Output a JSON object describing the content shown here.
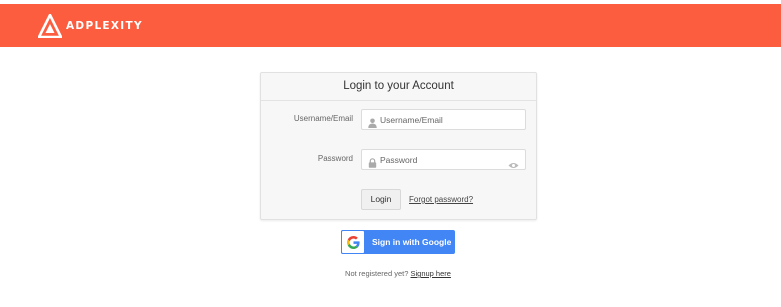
{
  "header": {
    "brand": "ADPLEXITY",
    "bar_color": "#fc5d3f"
  },
  "login_card": {
    "title": "Login to your Account",
    "username": {
      "label": "Username/Email",
      "placeholder": "Username/Email",
      "value": "",
      "icon": "user-icon"
    },
    "password": {
      "label": "Password",
      "placeholder": "Password",
      "value": "",
      "icon": "lock-icon",
      "toggle_icon": "eye-icon"
    },
    "login_label": "Login",
    "forgot_label": "Forgot password?"
  },
  "google": {
    "label": "Sign in with Google",
    "icon": "google-icon",
    "color": "#4285f4"
  },
  "signup": {
    "prompt": "Not registered yet?",
    "link": "Signup here"
  }
}
